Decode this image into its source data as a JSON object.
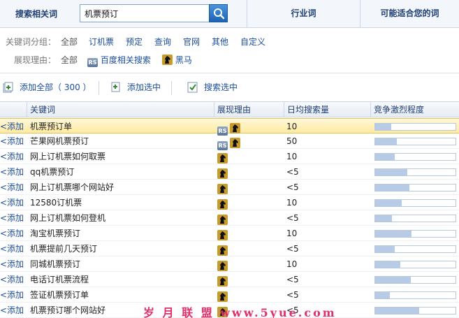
{
  "header": {
    "left_label": "搜索相关词",
    "search_value": "机票预订",
    "search_button_icon": "search-icon",
    "tabs": [
      {
        "label": "行业词"
      },
      {
        "label": "可能适合您的词"
      }
    ]
  },
  "filters": {
    "group_label": "关键词分组：",
    "groups": [
      "全部",
      "订机票",
      "预定",
      "查询",
      "官网",
      "其他",
      "自定义"
    ],
    "reason_label": "展现理由：",
    "reasons": [
      {
        "label": "全部",
        "badge": ""
      },
      {
        "label": "百度相关搜索",
        "badge": "RS"
      },
      {
        "label": "黑马",
        "badge": "horse"
      }
    ]
  },
  "toolbar": {
    "add_all": "添加全部",
    "add_all_count": "（ 300 ）",
    "add_selected": "添加选中",
    "search_selected": "搜索选中"
  },
  "table": {
    "columns": [
      "关键词",
      "展现理由",
      "日均搜索量",
      "竞争激烈程度"
    ],
    "add_label": "<添加",
    "rows": [
      {
        "keyword": "机票预订单",
        "reasons": [
          "RS",
          "horse"
        ],
        "avg": "10",
        "competition": 0.2
      },
      {
        "keyword": "芒果网机票预订",
        "reasons": [
          "RS",
          "horse"
        ],
        "avg": "50",
        "competition": 0.27
      },
      {
        "keyword": "网上订机票如何取票",
        "reasons": [
          "horse"
        ],
        "avg": "10",
        "competition": 0.24
      },
      {
        "keyword": "qq机票预订",
        "reasons": [
          "horse"
        ],
        "avg": "<5",
        "competition": 0.4
      },
      {
        "keyword": "网上订机票哪个网站好",
        "reasons": [
          "horse"
        ],
        "avg": "<5",
        "competition": 0.43
      },
      {
        "keyword": "12580订机票",
        "reasons": [
          "horse"
        ],
        "avg": "10",
        "competition": 0.33
      },
      {
        "keyword": "网上订机票如何登机",
        "reasons": [
          "horse"
        ],
        "avg": "<5",
        "competition": 0.21
      },
      {
        "keyword": "淘宝机票预订",
        "reasons": [
          "horse"
        ],
        "avg": "10",
        "competition": 0.45
      },
      {
        "keyword": "机票提前几天预订",
        "reasons": [
          "horse"
        ],
        "avg": "<5",
        "competition": 0.24
      },
      {
        "keyword": "同城机票预订",
        "reasons": [
          "horse"
        ],
        "avg": "10",
        "competition": 0.31
      },
      {
        "keyword": "电话订机票流程",
        "reasons": [
          "horse"
        ],
        "avg": "<5",
        "competition": 0.44
      },
      {
        "keyword": "签证机票预订单",
        "reasons": [
          "horse"
        ],
        "avg": "<5",
        "competition": 0.18
      },
      {
        "keyword": "机票预订哪个网站好",
        "reasons": [
          "horse"
        ],
        "avg": "<5",
        "competition": 0.55
      }
    ]
  },
  "watermark": "岁 月 联 盟 www.5yue.com"
}
